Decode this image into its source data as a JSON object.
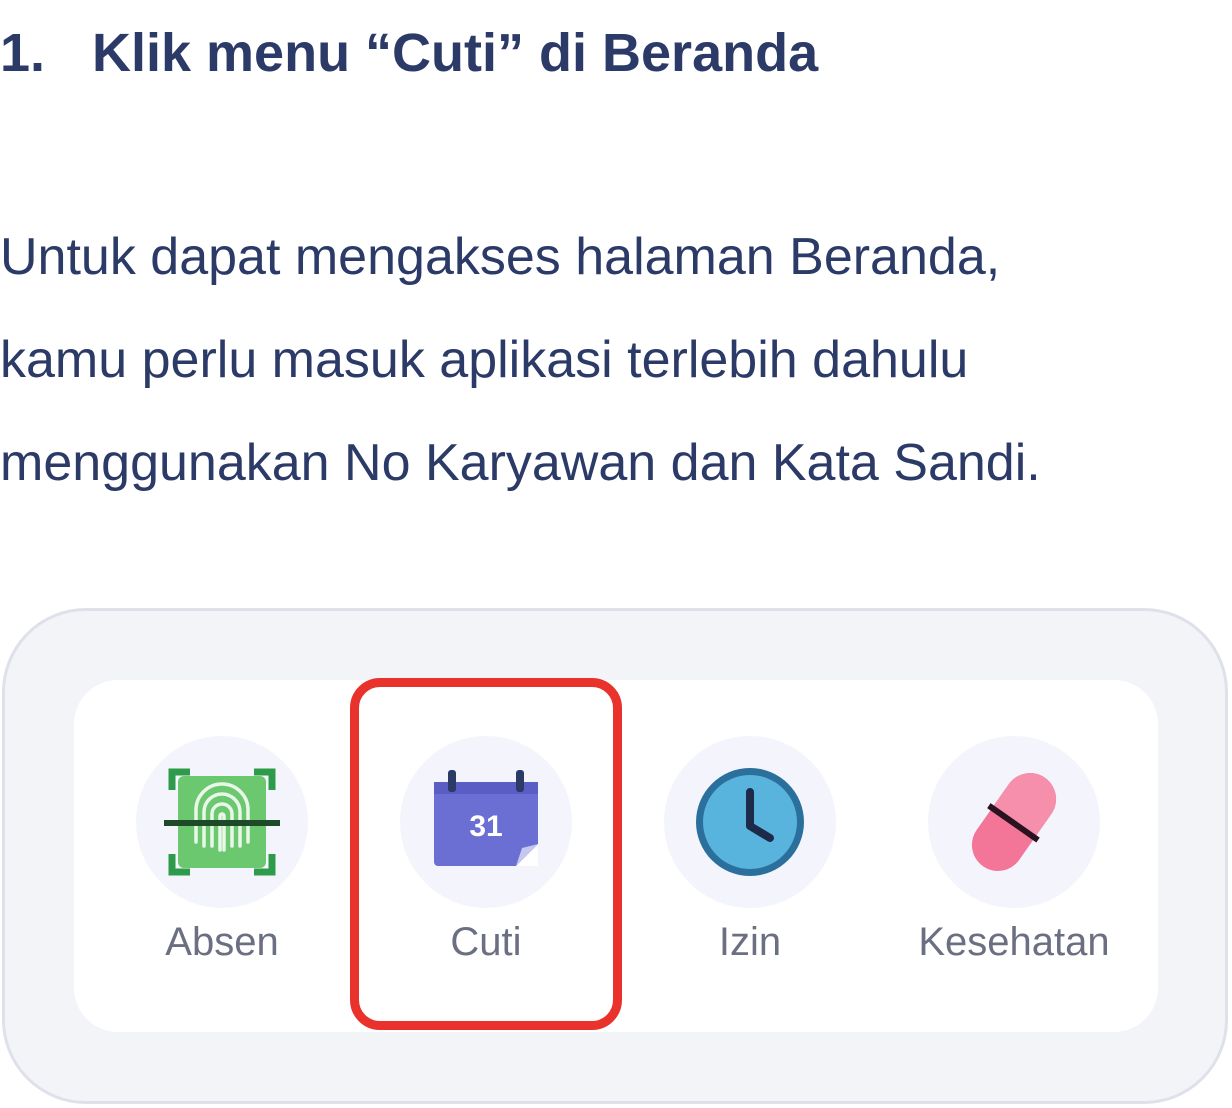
{
  "step": {
    "number": "1.",
    "title": "Klik menu “Cuti” di Beranda"
  },
  "description": {
    "lines": [
      "Untuk dapat mengakses halaman Beranda,",
      "kamu perlu masuk aplikasi terlebih dahulu",
      "menggunakan No Karyawan dan Kata Sandi."
    ]
  },
  "menu": {
    "items": [
      {
        "label": "Absen",
        "icon": "fingerprint-scan-icon"
      },
      {
        "label": "Cuti",
        "icon": "calendar-icon",
        "icon_text": "31"
      },
      {
        "label": "Izin",
        "icon": "clock-icon"
      },
      {
        "label": "Kesehatan",
        "icon": "pill-icon"
      }
    ],
    "highlighted_item": "Cuti"
  },
  "colors": {
    "text": "#2b3a67",
    "menu_label": "#6b6f82",
    "highlight": "#e8322b",
    "frame_background": "#f3f4f8",
    "card_background": "#ffffff",
    "icon_circle": "#f4f5fc",
    "absen_green": "#6cc86f",
    "cuti_purple": "#6b6fd4",
    "izin_blue": "#58b4dc",
    "kesehatan_pink": "#f37597"
  }
}
